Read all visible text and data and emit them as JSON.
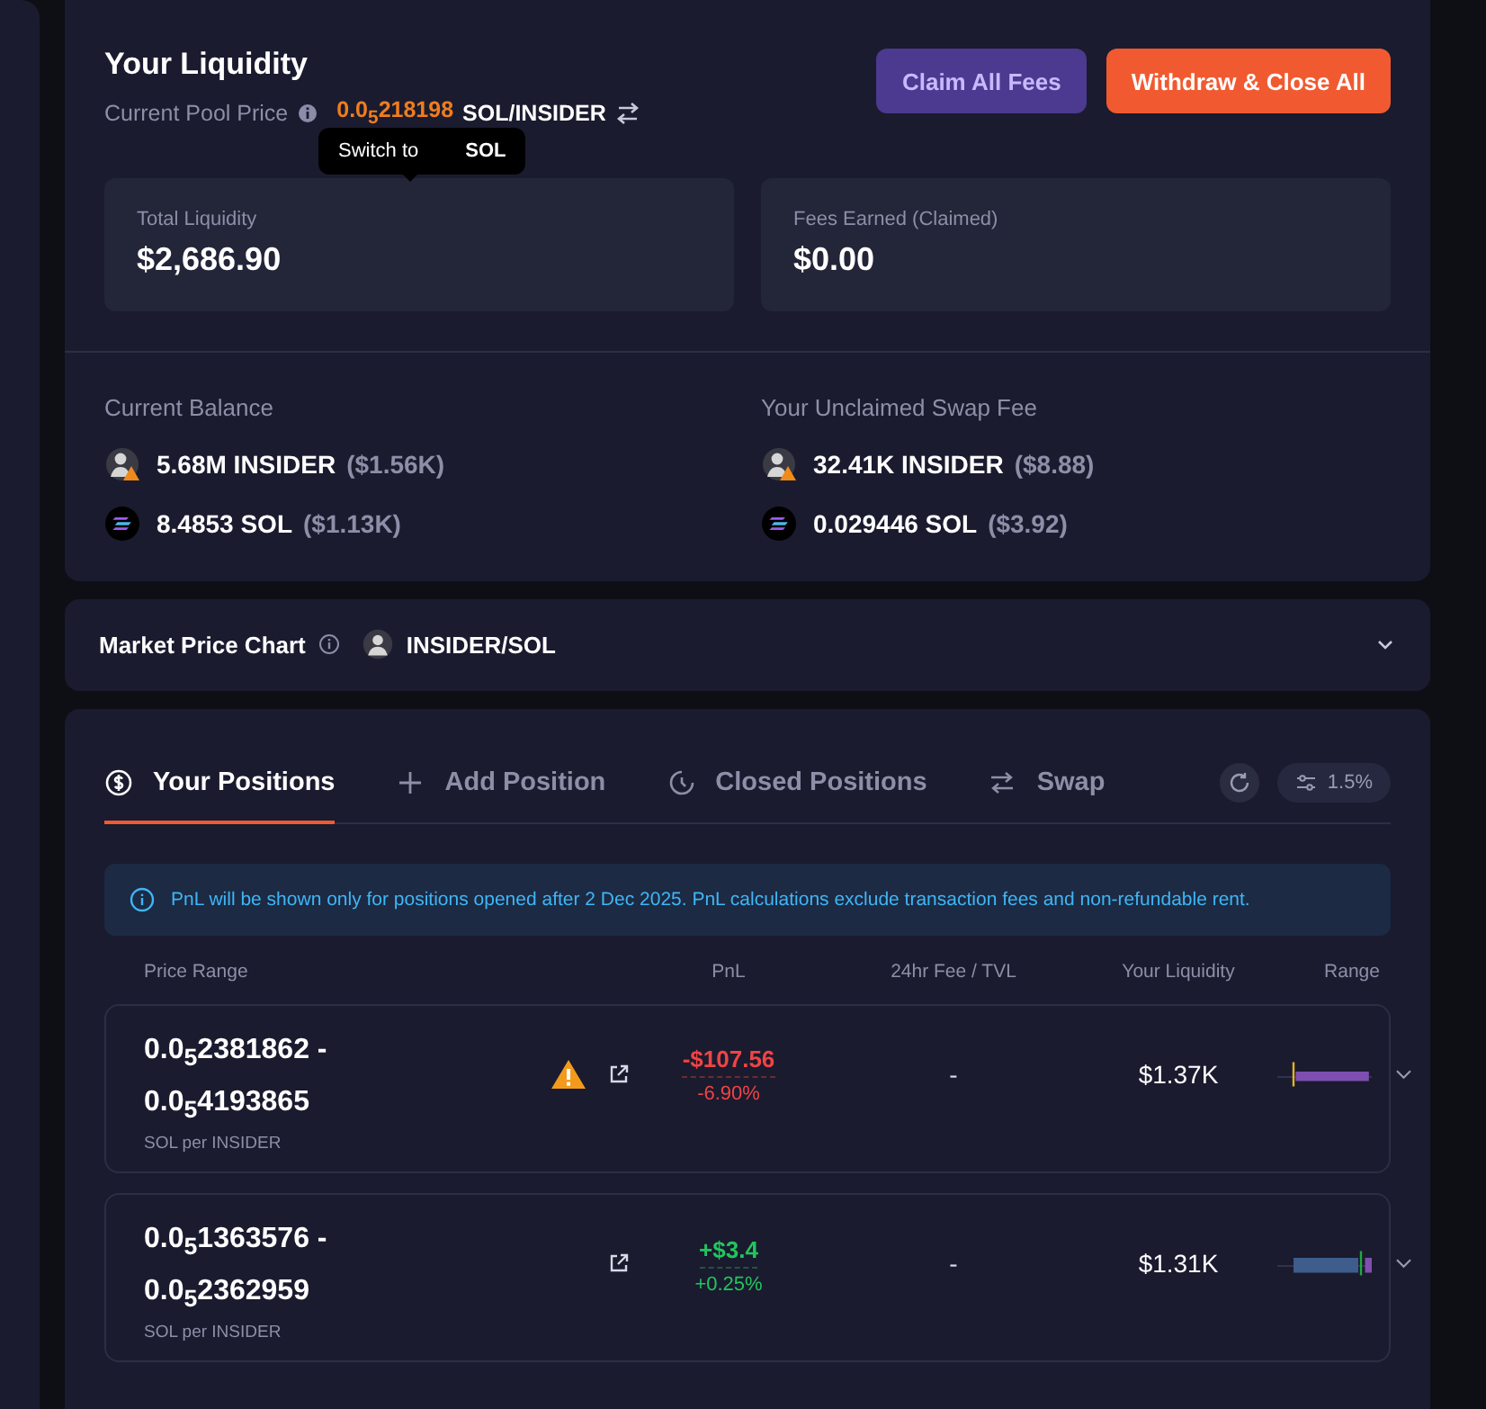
{
  "liquidity": {
    "title": "Your Liquidity",
    "pool_price_label": "Current Pool Price",
    "pool_price_value": "0.0$_{5}$218198",
    "pool_price_pair": "SOL/INSIDER",
    "tooltip": {
      "text": "Switch to",
      "token": "SOL"
    },
    "buttons": [
      {
        "label": "Claim All Fees",
        "kind": "secondary"
      },
      {
        "label": "Withdraw & Close All",
        "kind": "primary"
      }
    ],
    "stats": [
      {
        "label": "Total Liquidity",
        "value": "$2,686.90"
      },
      {
        "label": "Fees Earned (Claimed)",
        "value": "$0.00"
      }
    ],
    "balances": [
      {
        "title": "Current Balance",
        "items": [
          {
            "kind": "insider",
            "amount": "5.68M INSIDER",
            "usd": "($1.56K)"
          },
          {
            "kind": "sol",
            "amount": "8.4853 SOL",
            "usd": "($1.13K)"
          }
        ]
      },
      {
        "title": "Your Unclaimed Swap Fee",
        "items": [
          {
            "kind": "insider",
            "amount": "32.41K INSIDER",
            "usd": "($8.88)"
          },
          {
            "kind": "sol",
            "amount": "0.029446 SOL",
            "usd": "($3.92)"
          }
        ]
      }
    ]
  },
  "market_chart": {
    "title": "Market Price Chart",
    "pair": "INSIDER/SOL",
    "expanded": false
  },
  "positions": {
    "tabs": [
      {
        "label": "Your Positions",
        "kind": "dollar",
        "selected": true
      },
      {
        "label": "Add Position",
        "kind": "plus",
        "selected": false
      },
      {
        "label": "Closed Positions",
        "kind": "clock",
        "selected": false
      },
      {
        "label": "Swap",
        "kind": "swap",
        "selected": false
      }
    ],
    "slippage": "1.5%",
    "notice": "PnL will be shown only for positions opened after 2 Dec 2025. PnL calculations exclude transaction fees and non-refundable rent.",
    "columns": [
      "Price Range",
      "PnL",
      "24hr Fee / TVL",
      "Your Liquidity",
      "Range"
    ],
    "rows": [
      {
        "range_low": "0.0$_{5}$2381862 -",
        "range_high": "0.0$_{5}$4193865",
        "unit": "SOL per INSIDER",
        "warning": true,
        "pnl": "-$107.56",
        "pnl_pct": "-6.90%",
        "kind": "loss",
        "fee_tvl": "-",
        "liquidity": "$1.37K"
      },
      {
        "range_low": "0.0$_{5}$1363576 -",
        "range_high": "0.0$_{5}$2362959",
        "unit": "SOL per INSIDER",
        "warning": false,
        "pnl": "+$3.4",
        "pnl_pct": "+0.25%",
        "kind": "gain",
        "fee_tvl": "-",
        "liquidity": "$1.31K"
      }
    ]
  }
}
